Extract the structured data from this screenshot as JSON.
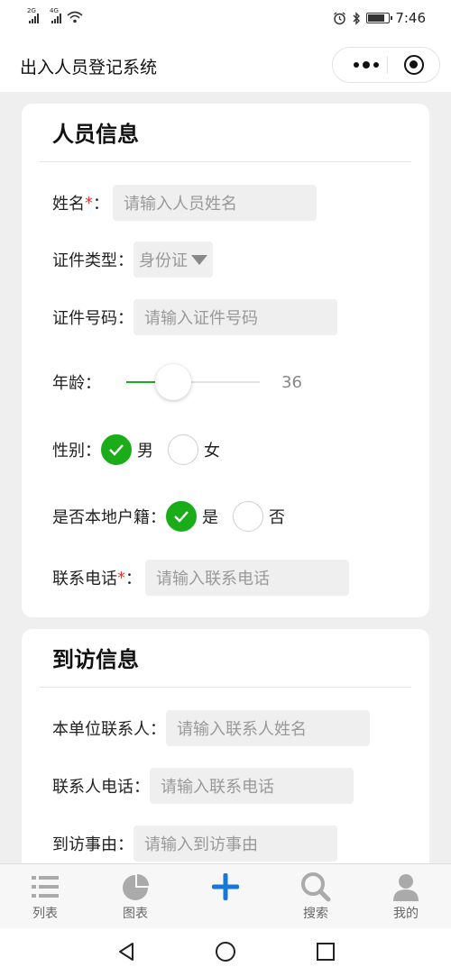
{
  "status_bar": {
    "signal1_label": "2G",
    "signal2_label": "4G",
    "time": "7:46",
    "icons": [
      "alarm-icon",
      "bluetooth-icon",
      "battery-icon"
    ]
  },
  "app": {
    "title": "出入人员登记系统"
  },
  "person_section": {
    "title": "人员信息",
    "name_label": "姓名",
    "name_required": "*",
    "name_colon": "：",
    "name_placeholder": "请输入人员姓名",
    "id_type_label": "证件类型：",
    "id_type_value": "身份证",
    "id_number_label": "证件号码：",
    "id_number_placeholder": "请输入证件号码",
    "age_label": "年龄：",
    "age_value": "36",
    "age_slider_fraction": 0.3,
    "gender_label": "性别：",
    "gender_options": [
      "男",
      "女"
    ],
    "gender_selected": "男",
    "local_label": "是否本地户籍：",
    "local_options": [
      "是",
      "否"
    ],
    "local_selected": "是",
    "phone_label": "联系电话",
    "phone_required": "*",
    "phone_colon": "：",
    "phone_placeholder": "请输入联系电话"
  },
  "visit_section": {
    "title": "到访信息",
    "contact_label": "本单位联系人：",
    "contact_placeholder": "请输入联系人姓名",
    "contact_phone_label": "联系人电话：",
    "contact_phone_placeholder": "请输入联系电话",
    "reason_label": "到访事由：",
    "reason_placeholder": "请输入到访事由"
  },
  "tabbar": {
    "tabs": [
      {
        "label": "列表",
        "icon": "list-icon"
      },
      {
        "label": "图表",
        "icon": "pie-chart-icon"
      },
      {
        "label": "",
        "icon": "add-icon"
      },
      {
        "label": "搜索",
        "icon": "search-icon"
      },
      {
        "label": "我的",
        "icon": "user-icon"
      }
    ]
  },
  "colors": {
    "accent_green": "#1aad19",
    "add_blue": "#1677d9",
    "required_red": "#e53935"
  }
}
